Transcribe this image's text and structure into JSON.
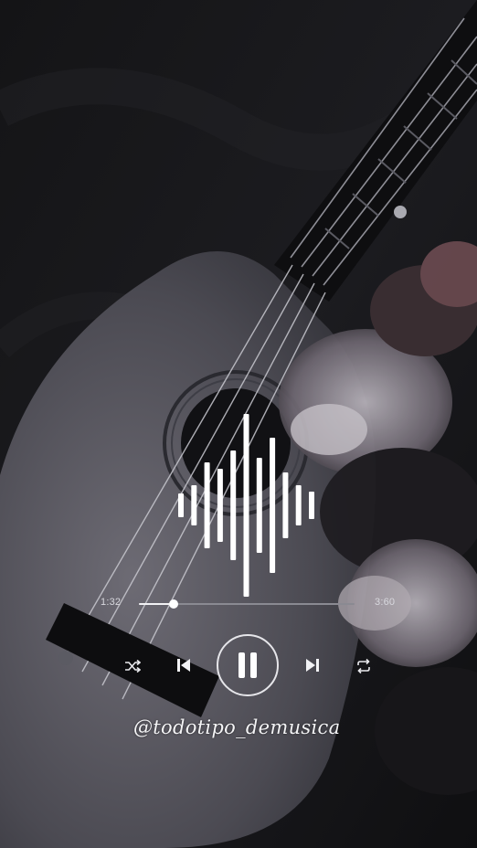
{
  "player": {
    "elapsed": "1:32",
    "total": "3:60",
    "progress_fraction": 0.16,
    "waveform_levels": [
      0.13,
      0.22,
      0.47,
      0.4,
      0.6,
      1.0,
      0.52,
      0.74,
      0.36,
      0.22,
      0.15
    ],
    "controls": {
      "shuffle_icon": "shuffle-icon",
      "prev_icon": "skip-previous-icon",
      "play_pause_icon": "pause-icon",
      "next_icon": "skip-next-icon",
      "repeat_icon": "repeat-icon"
    }
  },
  "watermark": "@todotipo_demusica",
  "colors": {
    "accent": "#ffffff",
    "track": "#8a8a92",
    "background": "#0c0c0e"
  }
}
